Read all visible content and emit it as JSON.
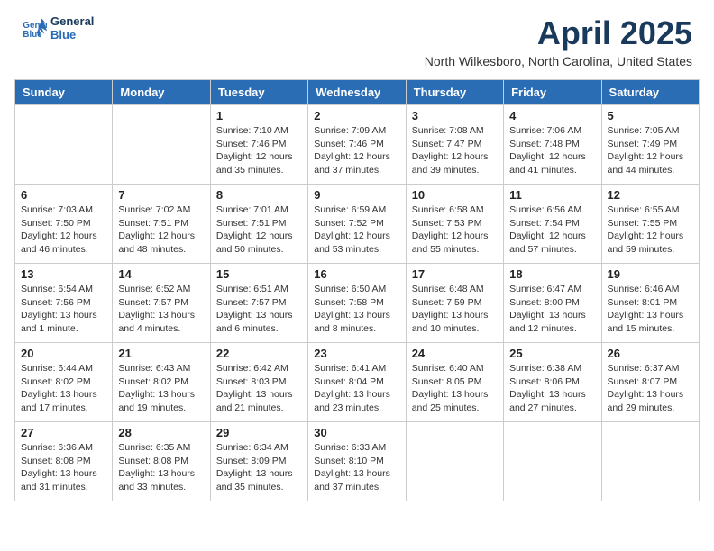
{
  "logo": {
    "line1": "General",
    "line2": "Blue"
  },
  "title": "April 2025",
  "subtitle": "North Wilkesboro, North Carolina, United States",
  "weekdays": [
    "Sunday",
    "Monday",
    "Tuesday",
    "Wednesday",
    "Thursday",
    "Friday",
    "Saturday"
  ],
  "weeks": [
    [
      {
        "day": "",
        "info": ""
      },
      {
        "day": "",
        "info": ""
      },
      {
        "day": "1",
        "info": "Sunrise: 7:10 AM\nSunset: 7:46 PM\nDaylight: 12 hours\nand 35 minutes."
      },
      {
        "day": "2",
        "info": "Sunrise: 7:09 AM\nSunset: 7:46 PM\nDaylight: 12 hours\nand 37 minutes."
      },
      {
        "day": "3",
        "info": "Sunrise: 7:08 AM\nSunset: 7:47 PM\nDaylight: 12 hours\nand 39 minutes."
      },
      {
        "day": "4",
        "info": "Sunrise: 7:06 AM\nSunset: 7:48 PM\nDaylight: 12 hours\nand 41 minutes."
      },
      {
        "day": "5",
        "info": "Sunrise: 7:05 AM\nSunset: 7:49 PM\nDaylight: 12 hours\nand 44 minutes."
      }
    ],
    [
      {
        "day": "6",
        "info": "Sunrise: 7:03 AM\nSunset: 7:50 PM\nDaylight: 12 hours\nand 46 minutes."
      },
      {
        "day": "7",
        "info": "Sunrise: 7:02 AM\nSunset: 7:51 PM\nDaylight: 12 hours\nand 48 minutes."
      },
      {
        "day": "8",
        "info": "Sunrise: 7:01 AM\nSunset: 7:51 PM\nDaylight: 12 hours\nand 50 minutes."
      },
      {
        "day": "9",
        "info": "Sunrise: 6:59 AM\nSunset: 7:52 PM\nDaylight: 12 hours\nand 53 minutes."
      },
      {
        "day": "10",
        "info": "Sunrise: 6:58 AM\nSunset: 7:53 PM\nDaylight: 12 hours\nand 55 minutes."
      },
      {
        "day": "11",
        "info": "Sunrise: 6:56 AM\nSunset: 7:54 PM\nDaylight: 12 hours\nand 57 minutes."
      },
      {
        "day": "12",
        "info": "Sunrise: 6:55 AM\nSunset: 7:55 PM\nDaylight: 12 hours\nand 59 minutes."
      }
    ],
    [
      {
        "day": "13",
        "info": "Sunrise: 6:54 AM\nSunset: 7:56 PM\nDaylight: 13 hours\nand 1 minute."
      },
      {
        "day": "14",
        "info": "Sunrise: 6:52 AM\nSunset: 7:57 PM\nDaylight: 13 hours\nand 4 minutes."
      },
      {
        "day": "15",
        "info": "Sunrise: 6:51 AM\nSunset: 7:57 PM\nDaylight: 13 hours\nand 6 minutes."
      },
      {
        "day": "16",
        "info": "Sunrise: 6:50 AM\nSunset: 7:58 PM\nDaylight: 13 hours\nand 8 minutes."
      },
      {
        "day": "17",
        "info": "Sunrise: 6:48 AM\nSunset: 7:59 PM\nDaylight: 13 hours\nand 10 minutes."
      },
      {
        "day": "18",
        "info": "Sunrise: 6:47 AM\nSunset: 8:00 PM\nDaylight: 13 hours\nand 12 minutes."
      },
      {
        "day": "19",
        "info": "Sunrise: 6:46 AM\nSunset: 8:01 PM\nDaylight: 13 hours\nand 15 minutes."
      }
    ],
    [
      {
        "day": "20",
        "info": "Sunrise: 6:44 AM\nSunset: 8:02 PM\nDaylight: 13 hours\nand 17 minutes."
      },
      {
        "day": "21",
        "info": "Sunrise: 6:43 AM\nSunset: 8:02 PM\nDaylight: 13 hours\nand 19 minutes."
      },
      {
        "day": "22",
        "info": "Sunrise: 6:42 AM\nSunset: 8:03 PM\nDaylight: 13 hours\nand 21 minutes."
      },
      {
        "day": "23",
        "info": "Sunrise: 6:41 AM\nSunset: 8:04 PM\nDaylight: 13 hours\nand 23 minutes."
      },
      {
        "day": "24",
        "info": "Sunrise: 6:40 AM\nSunset: 8:05 PM\nDaylight: 13 hours\nand 25 minutes."
      },
      {
        "day": "25",
        "info": "Sunrise: 6:38 AM\nSunset: 8:06 PM\nDaylight: 13 hours\nand 27 minutes."
      },
      {
        "day": "26",
        "info": "Sunrise: 6:37 AM\nSunset: 8:07 PM\nDaylight: 13 hours\nand 29 minutes."
      }
    ],
    [
      {
        "day": "27",
        "info": "Sunrise: 6:36 AM\nSunset: 8:08 PM\nDaylight: 13 hours\nand 31 minutes."
      },
      {
        "day": "28",
        "info": "Sunrise: 6:35 AM\nSunset: 8:08 PM\nDaylight: 13 hours\nand 33 minutes."
      },
      {
        "day": "29",
        "info": "Sunrise: 6:34 AM\nSunset: 8:09 PM\nDaylight: 13 hours\nand 35 minutes."
      },
      {
        "day": "30",
        "info": "Sunrise: 6:33 AM\nSunset: 8:10 PM\nDaylight: 13 hours\nand 37 minutes."
      },
      {
        "day": "",
        "info": ""
      },
      {
        "day": "",
        "info": ""
      },
      {
        "day": "",
        "info": ""
      }
    ]
  ]
}
